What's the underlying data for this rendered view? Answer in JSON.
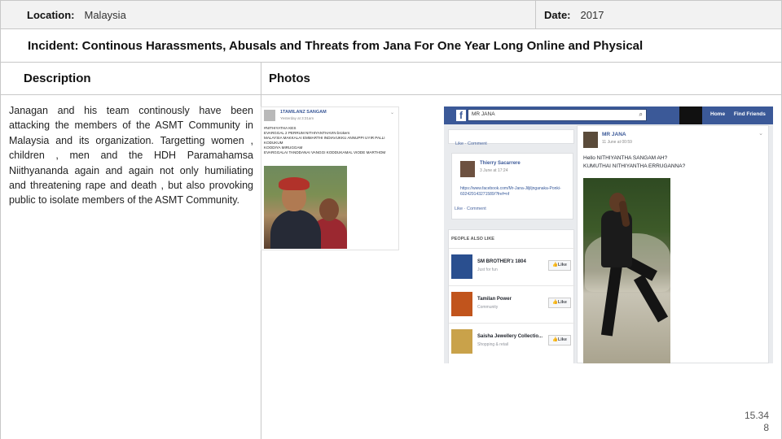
{
  "header": {
    "location_label": "Location:",
    "location_value": "Malaysia",
    "date_label": "Date:",
    "date_value": "2017"
  },
  "incident_title": "Incident: Continous Harassments, Abusals and Threats from Jana For One Year Long Online and Physical",
  "columns": {
    "description": "Description",
    "photos": "Photos"
  },
  "description_text": "Janagan and his team continously have been attacking the members of the ASMT Community in Malaysia and its organization. Targetting women , children , men and the HDH Paramahamsa Niithyananda again and again not only humiliating and threatening rape and death , but also provoking public to isolate members of the ASMT Community.",
  "page_number": {
    "line1": "15.34",
    "line2": "8"
  },
  "screenshot_post": {
    "author": "1TAMILANZ SANGAM",
    "time": "Yesterday at 3:31am",
    "lines": [
      "#NITHIYATHA KES",
      "EVARGGAL 2 PERRUM NITHIYANTHAVIN brokers",
      "MALAYSIA MAKKALAI EMMARTHI INDIAVUKKU ANNUPPI UYIR PALLI",
      "KODUKUM",
      "KOODIYA MIRUGGAM",
      "EVARGGALAI TANDDANAI VANGGI KODDUKAMAL VIODE MARTHOM"
    ]
  },
  "screenshot_fb": {
    "search_text": "MR JANA",
    "nav": [
      "Home",
      "Find Friends"
    ],
    "like_comment": "Like · Comment",
    "comment_author": "Thierry Sacarrere",
    "comment_time": "3 June at 17:24",
    "comment_url": "https://www.facebook.com/Mr-Jana-Jiljiljnganaka-Ponki-602429143271589/?fref=nf",
    "people_also_like_title": "PEOPLE ALSO LIKE",
    "pages": [
      {
        "name": "SM BROTHER'z 1804",
        "category": "Just for fun",
        "like": "Like"
      },
      {
        "name": "Tamilan Power",
        "category": "Community",
        "like": "Like"
      },
      {
        "name": "Saisha Jewellery Collectio...",
        "category": "Shopping & retail",
        "like": "Like"
      }
    ],
    "post_author": "MR JANA",
    "post_time": "11 June at 00:59",
    "post_lines": [
      "Hello NITHIYANTHA SANGAM AH?",
      "KUMUTHAI NITHIYANTHA ERRUGANNA?"
    ]
  }
}
